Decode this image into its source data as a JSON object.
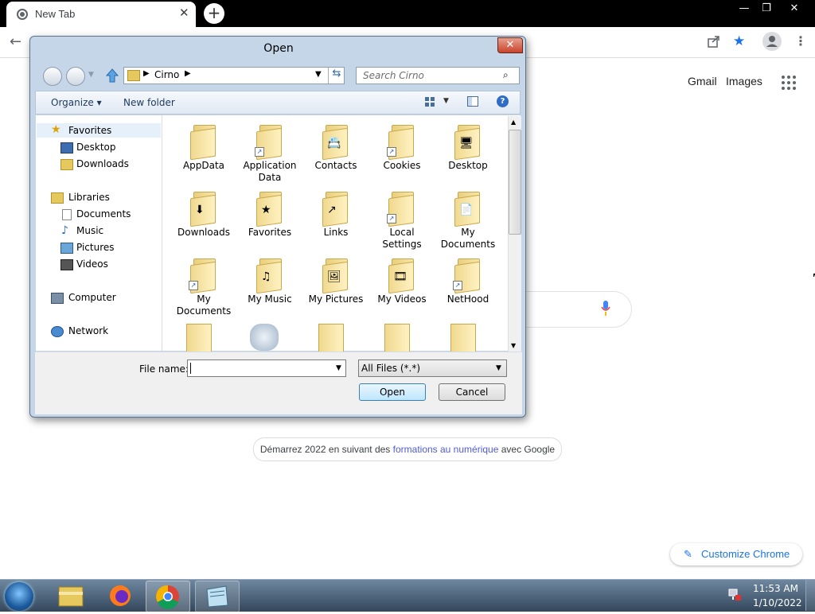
{
  "browser": {
    "tab_title": "New Tab",
    "tab_close": "✕",
    "new_tab": "+",
    "window_controls": {
      "minimize": "—",
      "restore": "❐",
      "close": "✕"
    },
    "google": {
      "gmail": "Gmail",
      "images": "Images",
      "promo_before": "Démarrez 2022 en suivant des ",
      "promo_link": "formations au numérique",
      "promo_after": " avec Google",
      "customize": "Customize Chrome"
    }
  },
  "dialog": {
    "title": "Open",
    "close": "✕",
    "address": [
      "Cirno"
    ],
    "search_placeholder": "Search Cirno",
    "toolbar": {
      "organize": "Organize",
      "new_folder": "New folder"
    },
    "nav": {
      "favorites": "Favorites",
      "favorites_items": [
        "Desktop",
        "Downloads"
      ],
      "libraries": "Libraries",
      "libraries_items": [
        "Documents",
        "Music",
        "Pictures",
        "Videos"
      ],
      "computer": "Computer",
      "network": "Network"
    },
    "files": [
      {
        "name": "AppData",
        "icon": "folder"
      },
      {
        "name": "Application Data",
        "icon": "folder-shortcut"
      },
      {
        "name": "Contacts",
        "icon": "folder-contacts"
      },
      {
        "name": "Cookies",
        "icon": "folder-shortcut"
      },
      {
        "name": "Desktop",
        "icon": "folder-desktop"
      },
      {
        "name": "Downloads",
        "icon": "folder-downloads"
      },
      {
        "name": "Favorites",
        "icon": "folder-favorites"
      },
      {
        "name": "Links",
        "icon": "folder-links"
      },
      {
        "name": "Local Settings",
        "icon": "folder-shortcut"
      },
      {
        "name": "My Documents",
        "icon": "folder-documents"
      },
      {
        "name": "My Documents",
        "icon": "folder-shortcut"
      },
      {
        "name": "My Music",
        "icon": "folder-music"
      },
      {
        "name": "My Pictures",
        "icon": "folder-pictures"
      },
      {
        "name": "My Videos",
        "icon": "folder-videos"
      },
      {
        "name": "NetHood",
        "icon": "folder-shortcut"
      }
    ],
    "file_name_label": "File name:",
    "file_name_value": "",
    "file_type": "All Files (*.*)",
    "open_button": "Open",
    "cancel_button": "Cancel"
  },
  "taskbar": {
    "time": "11:53 AM",
    "date": "1/10/2022"
  }
}
